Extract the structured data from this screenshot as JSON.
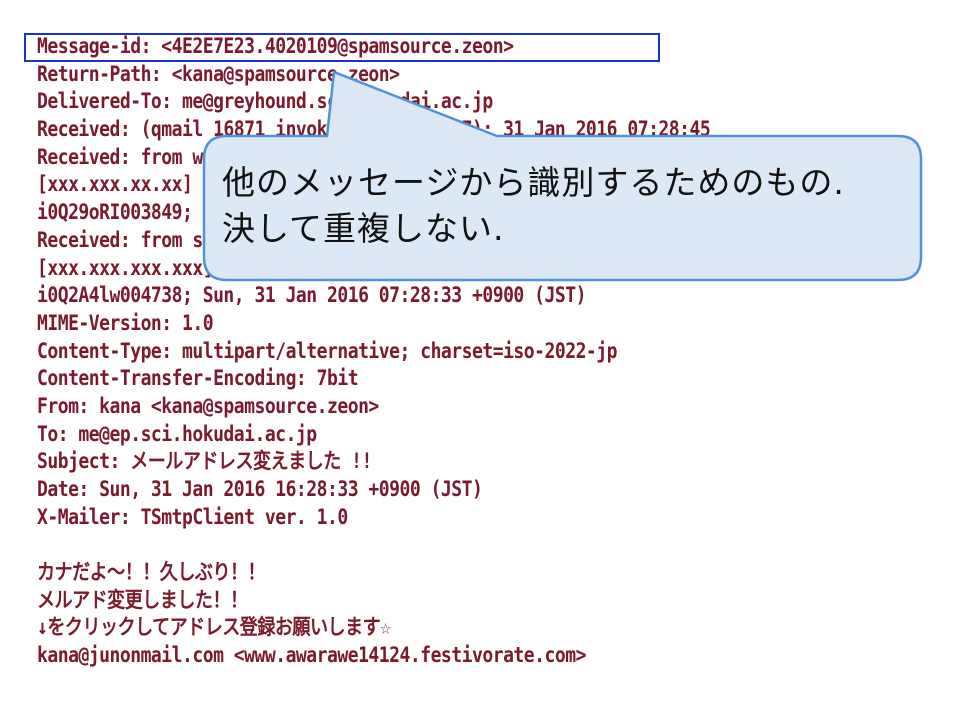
{
  "email": {
    "lines": [
      "Message-id: <4E2E7E23.4020109@spamsource.zeon>",
      "Return-Path: <kana@spamsource.zeon>",
      "Delivered-To: me@greyhound.sci.hokudai.ac.jp",
      "Received: (qmail 16871 invoked by uid 1467); 31 Jan 2016 07:28:45",
      "Received: from wickedrelay.com (HELO wickedrelay.com)",
      "[xxx.xxx.xx.xx] by greyhound.sci.hokudai.ac.jp",
      "i0Q29oRI003849; Sun, 31 Jan 2016 07:28:40 +0900 (JST)",
      "Received: from spamsource.zeon (spamsource.zeon",
      "[xxx.xxx.xxx.xxx]) by wickedrelay.com with SMTP id",
      "i0Q2A4lw004738; Sun, 31 Jan 2016 07:28:33 +0900 (JST)",
      "MIME-Version: 1.0",
      "Content-Type: multipart/alternative; charset=iso-2022-jp",
      "Content-Transfer-Encoding: 7bit",
      "From: kana <kana@spamsource.zeon>",
      "To: me@ep.sci.hokudai.ac.jp",
      "Subject: メールアドレス変えました !!",
      "Date: Sun, 31 Jan 2016 16:28:33 +0900 (JST)",
      "X-Mailer: TSmtpClient ver. 1.0",
      "",
      "カナだよ～！！久しぶり！！",
      "メルアド変更しました！！",
      "↓をクリックしてアドレス登録お願いします☆",
      "kana@junonmail.com <www.awarawe14124.festivorate.com>"
    ]
  },
  "callout": {
    "line1": "他のメッセージから識別するためのもの.",
    "line2": "決して重複しない."
  },
  "colors": {
    "text": "#7a1a2a",
    "highlight_border": "#1a33cc",
    "callout_fill": "#dce8f6",
    "callout_border": "#4f93d8"
  }
}
